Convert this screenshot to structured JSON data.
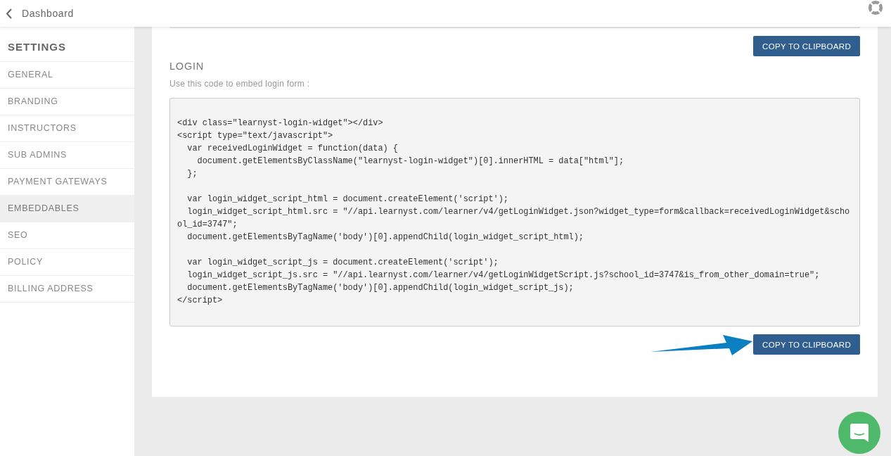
{
  "header": {
    "back_label": "Dashboard"
  },
  "sidebar": {
    "title": "SETTINGS",
    "items": [
      {
        "label": "GENERAL",
        "selected": false
      },
      {
        "label": "BRANDING",
        "selected": false
      },
      {
        "label": "INSTRUCTORS",
        "selected": false
      },
      {
        "label": "SUB ADMINS",
        "selected": false
      },
      {
        "label": "PAYMENT GATEWAYS",
        "selected": false
      },
      {
        "label": "EMBEDDABLES",
        "selected": true
      },
      {
        "label": "SEO",
        "selected": false
      },
      {
        "label": "POLICY",
        "selected": false
      },
      {
        "label": "BILLING ADDRESS",
        "selected": false
      }
    ]
  },
  "previous_section": {
    "button": "COPY TO CLIPBOARD"
  },
  "login_section": {
    "title": "LOGIN",
    "description": "Use this code to embed login form :",
    "code_blocks": [
      [
        "<div class=\"learnyst-login-widget\"></div>",
        "<script type=\"text/javascript\">",
        "  var receivedLoginWidget = function(data) {",
        "    document.getElementsByClassName(\"learnyst-login-widget\")[0].innerHTML = data[\"html\"];",
        "  };"
      ],
      [
        "  var login_widget_script_html = document.createElement('script');",
        "  login_widget_script_html.src = \"//api.learnyst.com/learner/v4/getLoginWidget.json?widget_type=form&callback=receivedLoginWidget&scho",
        "ol_id=3747\";",
        "  document.getElementsByTagName('body')[0].appendChild(login_widget_script_html);"
      ],
      [
        "  var login_widget_script_js = document.createElement('script');",
        "  login_widget_script_js.src = \"//api.learnyst.com/learner/v4/getLoginWidgetScript.js?school_id=3747&is_from_other_domain=true\";",
        "  document.getElementsByTagName('body')[0].appendChild(login_widget_script_js);",
        "</script>"
      ]
    ],
    "button": "COPY TO CLIPBOARD"
  }
}
